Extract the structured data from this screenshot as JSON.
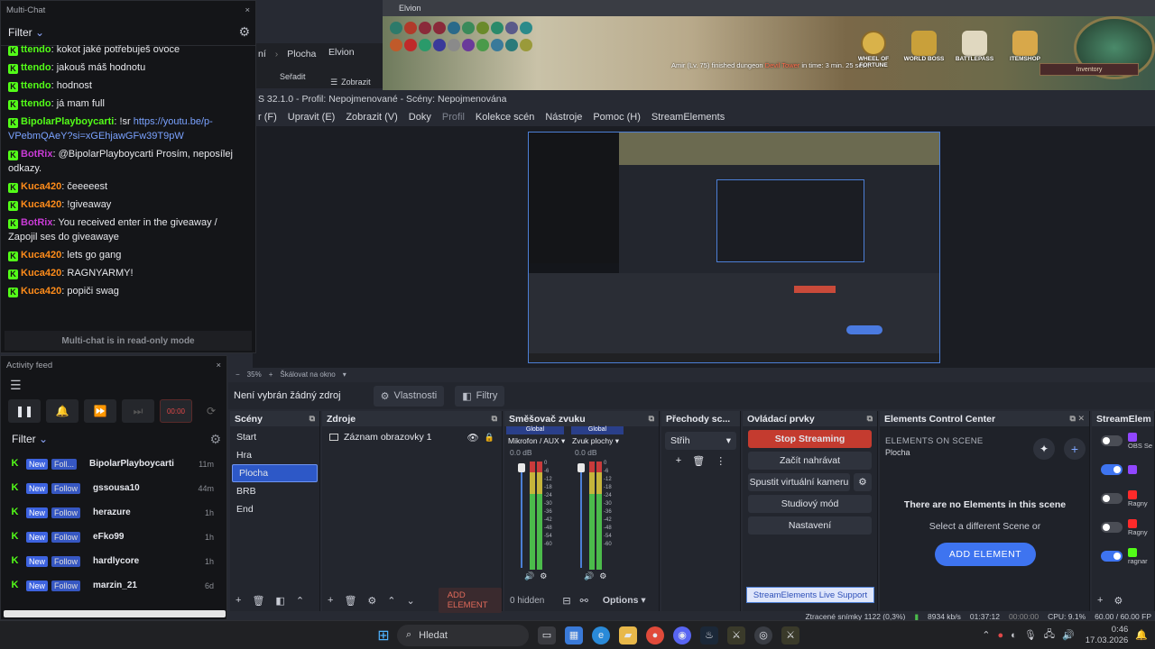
{
  "obs": {
    "titlebar": "S 32.1.0 - Profil: Nepojmenované - Scény: Nepojmenována",
    "menu": [
      "r (F)",
      "Upravit (E)",
      "Zobrazit (V)",
      "Doky",
      "Profil",
      "Kolekce scén",
      "Nástroje",
      "Pomoc (H)",
      "StreamElements"
    ],
    "explorer": {
      "path": [
        "ní",
        "Plocha",
        "Elvion"
      ],
      "sort": "Seřadit",
      "view": "Zobrazit"
    },
    "zoom": {
      "minus": "−",
      "value": "35%",
      "plus": "+",
      "scale_mode": "Škálovat na okno"
    },
    "source_bar": {
      "no_source": "Není vybrán žádný zdroj",
      "properties": "Vlastnosti",
      "filters": "Filtry"
    },
    "scenes": {
      "title": "Scény",
      "items": [
        "Start",
        "Hra",
        "Plocha",
        "BRB",
        "End"
      ],
      "selected": 2
    },
    "sources": {
      "title": "Zdroje",
      "items": [
        {
          "name": "Záznam obrazovky 1"
        }
      ],
      "add_element": "ADD ELEMENT"
    },
    "mixer": {
      "title": "Směšovač zvuku",
      "channels": [
        {
          "global": "Global",
          "name": "Mikrofon / AUX",
          "db": "0.0 dB"
        },
        {
          "global": "Global",
          "name": "Zvuk plochy",
          "db": "0.0 dB"
        }
      ],
      "scale": [
        "0",
        "-6",
        "-12",
        "-18",
        "-24",
        "-30",
        "-36",
        "-42",
        "-48",
        "-54",
        "-60"
      ],
      "hidden": "0 hidden",
      "options": "Options"
    },
    "transitions": {
      "title": "Přechody sc...",
      "selected": "Střih"
    },
    "controls": {
      "title": "Ovládací prvky",
      "stop_streaming": "Stop Streaming",
      "record": "Začít nahrávat",
      "virtual_cam": "Spustit virtuální kameru",
      "studio": "Studiový mód",
      "settings": "Nastavení",
      "live_support": "StreamElements Live Support"
    },
    "elements": {
      "title": "Elements Control Center",
      "on_scene": "ELEMENTS ON SCENE",
      "scene_name": "Plocha",
      "empty": "There are no Elements in this scene",
      "hint": "Select a different Scene or",
      "add": "ADD ELEMENT"
    },
    "streamelements_dock": {
      "title": "StreamElem",
      "items": [
        {
          "label": "OBS Se",
          "platform": "twitch",
          "on": false
        },
        {
          "label": "",
          "platform": "twitch",
          "on": true
        },
        {
          "label": "Ragny",
          "platform": "youtube",
          "on": false
        },
        {
          "label": "Ragny",
          "platform": "youtube",
          "on": false
        },
        {
          "label": "ragnar",
          "platform": "kick",
          "on": true
        }
      ]
    },
    "status": {
      "dropped": "Ztracené snímky 1122 (0,3%)",
      "kbps": "8934 kb/s",
      "live_time": "01:37:12",
      "rec_time": "00:00:00",
      "cpu": "CPU: 9.1%",
      "fps": "60.00 / 60.00 FP"
    }
  },
  "multichat": {
    "window_title": "Multi-Chat",
    "filter": "Filter",
    "messages": [
      {
        "user": "ttendo",
        "text": "kokot jaké potřebuješ ovoce",
        "color": "#53fc18",
        "badge": "kick"
      },
      {
        "user": "ttendo",
        "text": "jakouš máš hodnotu",
        "color": "#53fc18",
        "badge": "kick"
      },
      {
        "user": "ttendo",
        "text": "hodnost",
        "color": "#53fc18",
        "badge": "kick"
      },
      {
        "user": "ttendo",
        "text": "já mam full",
        "color": "#53fc18",
        "badge": "kick"
      },
      {
        "user": "BipolarPlayboycarti",
        "text": "!sr ",
        "link": "https://youtu.be/p-VPebmQAeY?si=xGEhjawGFw39T9pW",
        "color": "#53fc18",
        "badge": "kick"
      },
      {
        "user": "BotRix",
        "text": "@BipolarPlayboycarti Prosím, neposílej odkazy.",
        "color": "#c93bd6",
        "badge": "kick"
      },
      {
        "user": "Kuca420",
        "text": "čeeeeest",
        "color": "#ff8c1a",
        "badge": "kick"
      },
      {
        "user": "Kuca420",
        "text": "!giveaway",
        "color": "#ff8c1a",
        "badge": "kick"
      },
      {
        "user": "BotRix",
        "text": "You received enter in the giveaway / Zapojil ses do giveawaye",
        "color": "#c93bd6",
        "badge": "kick"
      },
      {
        "user": "Kuca420",
        "text": "lets go gang",
        "color": "#ff8c1a",
        "badge": "kick"
      },
      {
        "user": "Kuca420",
        "text": "RAGNYARMY!",
        "color": "#ff8c1a",
        "badge": "kick"
      },
      {
        "user": "Kuca420",
        "text": "popiči swag",
        "color": "#ff8c1a",
        "badge": "kick"
      }
    ],
    "readonly": "Multi-chat is in read-only mode"
  },
  "activity": {
    "window_title": "Activity feed",
    "timer": "00:00",
    "filter": "Filter",
    "rows": [
      {
        "new": "New",
        "type": "Foll...",
        "user": "BipolarPlayboycarti",
        "time": "11m"
      },
      {
        "new": "New",
        "type": "Follow",
        "user": "gssousa10",
        "time": "44m"
      },
      {
        "new": "New",
        "type": "Follow",
        "user": "herazure",
        "time": "1h"
      },
      {
        "new": "New",
        "type": "Follow",
        "user": "eFko99",
        "time": "1h"
      },
      {
        "new": "New",
        "type": "Follow",
        "user": "hardlycore",
        "time": "1h"
      },
      {
        "new": "New",
        "type": "Follow",
        "user": "marzin_21",
        "time": "6d"
      }
    ]
  },
  "game": {
    "window_title": "Elvion",
    "notice_prefix": "Amir (Lv. 75) finished dungeon ",
    "notice_dungeon": "Devil Tower",
    "notice_suffix": " in time: 3 min. 25 sec.!",
    "buttons": [
      "WHEEL OF FORTUNE",
      "WORLD BOSS",
      "BATTLEPASS",
      "ITEMSHOP"
    ],
    "inventory": "Inventory"
  },
  "taskbar": {
    "search": "Hledat",
    "time": "0:46",
    "date": "17.03.2026"
  }
}
